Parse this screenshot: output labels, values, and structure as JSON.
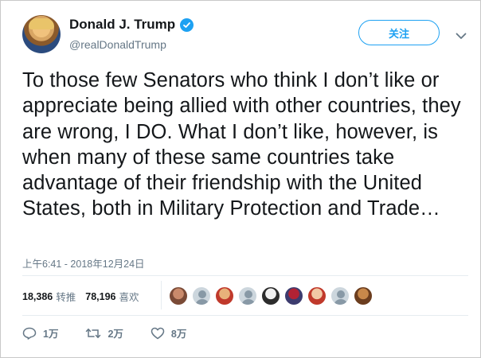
{
  "user": {
    "display_name": "Donald J. Trump",
    "handle": "@realDonaldTrump",
    "verified": true
  },
  "follow_button": {
    "label": "关注"
  },
  "tweet": {
    "text": "To those few Senators who think I don’t like or appreciate being allied with other countries, they are wrong, I DO. What I don’t like, however, is when many of these same countries take advantage of their friendship with the United States, both in Military Protection and Trade…",
    "timestamp": "上午6:41 - 2018年12月24日"
  },
  "stats": {
    "retweets_count": "18,386",
    "retweets_label": "转推",
    "likes_count": "78,196",
    "likes_label": "喜欢"
  },
  "likers": [
    {
      "kind": "photo",
      "colors": [
        "#c98a6b",
        "#7a4a36"
      ]
    },
    {
      "kind": "default"
    },
    {
      "kind": "photo",
      "colors": [
        "#e8b27a",
        "#c0392b"
      ]
    },
    {
      "kind": "default"
    },
    {
      "kind": "photo",
      "colors": [
        "#f1f1f1",
        "#2c2c2c"
      ]
    },
    {
      "kind": "photo",
      "colors": [
        "#b22234",
        "#3c3b6e"
      ]
    },
    {
      "kind": "photo",
      "colors": [
        "#f2c9a6",
        "#c0392b"
      ]
    },
    {
      "kind": "default"
    },
    {
      "kind": "photo",
      "colors": [
        "#c8884a",
        "#6b3d1e"
      ]
    }
  ],
  "actions": {
    "reply_count": "1万",
    "retweet_count": "2万",
    "like_count": "8万"
  },
  "colors": {
    "accent": "#1da1f2",
    "secondary_text": "#657786",
    "primary_text": "#14171a"
  }
}
